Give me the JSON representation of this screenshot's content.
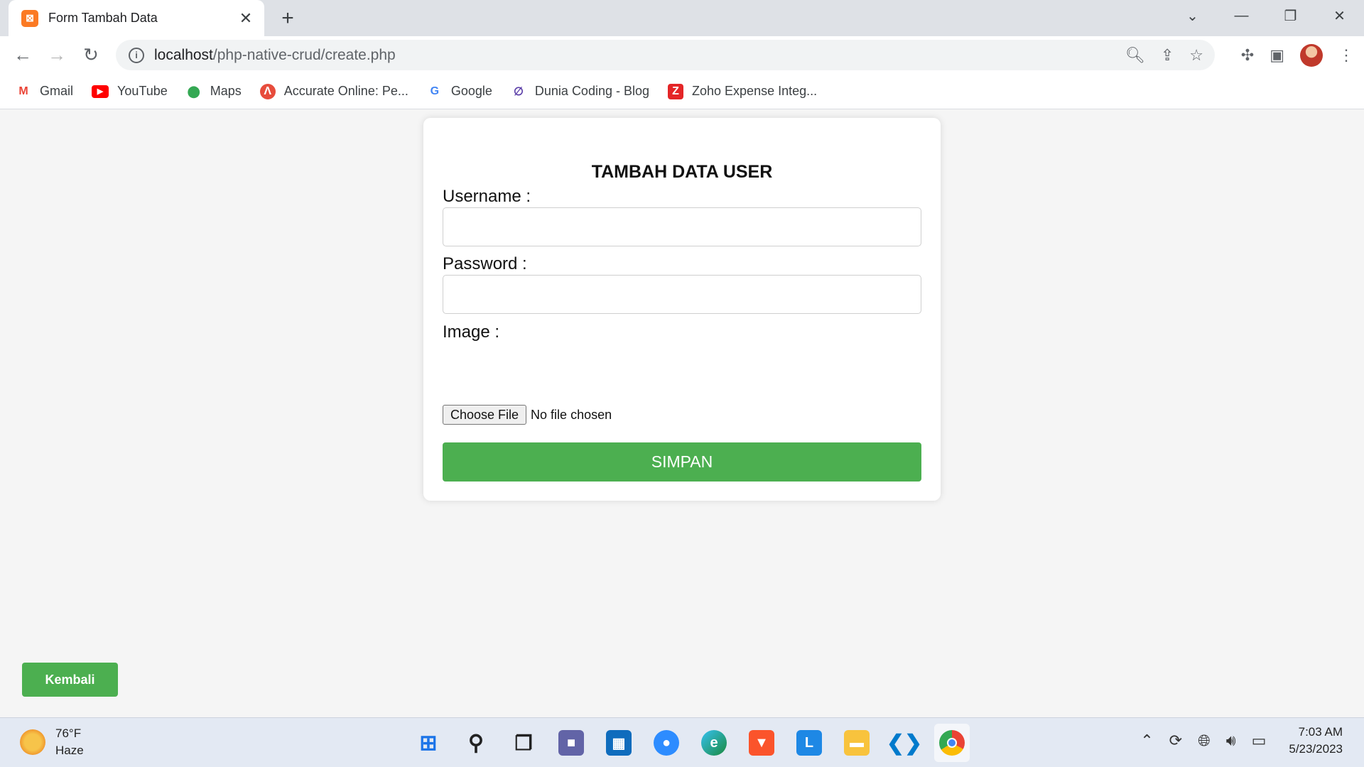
{
  "browser": {
    "tab_title": "Form Tambah Data",
    "url_host": "localhost",
    "url_path": "/php-native-crud/create.php",
    "bookmarks": [
      {
        "label": "Gmail",
        "icon": "gmail-icon"
      },
      {
        "label": "YouTube",
        "icon": "youtube-icon"
      },
      {
        "label": "Maps",
        "icon": "maps-icon"
      },
      {
        "label": "Accurate Online: Pe...",
        "icon": "accurate-icon"
      },
      {
        "label": "Google",
        "icon": "google-icon"
      },
      {
        "label": "Dunia Coding - Blog",
        "icon": "dunia-coding-icon"
      },
      {
        "label": "Zoho Expense Integ...",
        "icon": "zoho-icon"
      }
    ]
  },
  "form": {
    "title": "TAMBAH DATA USER",
    "username_label": "Username :",
    "username_value": "",
    "password_label": "Password :",
    "password_value": "",
    "image_label": "Image :",
    "choose_file_label": "Choose File",
    "file_status": "No file chosen",
    "submit_label": "SIMPAN",
    "accent_color": "#4caf50"
  },
  "page": {
    "back_label": "Kembali"
  },
  "taskbar": {
    "weather_temp": "76°F",
    "weather_desc": "Haze",
    "time": "7:03 AM",
    "date": "5/23/2023",
    "apps": [
      "start-icon",
      "search-icon",
      "task-view-icon",
      "chat-icon",
      "store-icon",
      "zoom-icon",
      "edge-icon",
      "brave-icon",
      "l-app-icon",
      "file-explorer-icon",
      "vscode-icon",
      "chrome-icon"
    ]
  }
}
